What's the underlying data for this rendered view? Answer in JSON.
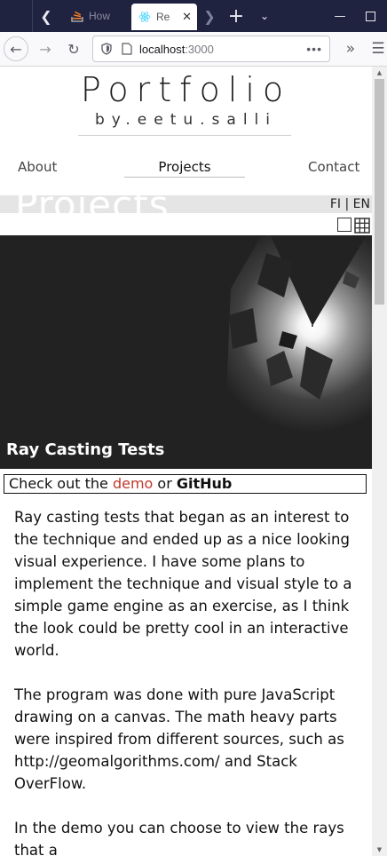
{
  "browser": {
    "tabs": [
      {
        "title": "How c",
        "active": false
      },
      {
        "title": "Re",
        "active": true
      }
    ],
    "url_host": "localhost",
    "url_port": ":3000"
  },
  "site": {
    "title": "Portfolio",
    "subtitle": "by.eetu.salli",
    "nav": {
      "about": "About",
      "projects": "Projects",
      "contact": "Contact"
    },
    "section_ghost": "Projects",
    "lang": "FI | EN"
  },
  "project": {
    "caption": "Ray Casting Tests",
    "links_prefix": "Check out the ",
    "demo_label": "demo",
    "links_mid": " or ",
    "github_label": "GitHub",
    "paragraphs": [
      "Ray casting tests that began as an interest to the technique and ended up as a nice looking visual experience. I have some plans to implement the technique and visual style to a simple game engine as an exercise, as I think the look could be pretty cool in an interactive world.",
      "The program was done with pure JavaScript drawing on a canvas. The math heavy parts were inspired from different sources, such as http://geomalgorithms.com/ and Stack OverFlow.",
      "In the demo you can choose to view the rays that a"
    ]
  },
  "colors": {
    "tabbar": "#202340",
    "hero_bg": "#222222",
    "demo_link": "#c0392b"
  }
}
